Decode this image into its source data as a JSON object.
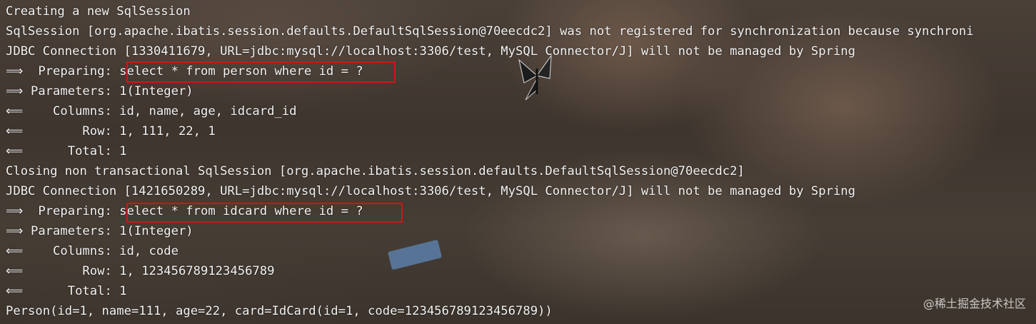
{
  "console": {
    "lines": [
      "Creating a new SqlSession",
      "SqlSession [org.apache.ibatis.session.defaults.DefaultSqlSession@70eecdc2] was not registered for synchronization because synchroni",
      "JDBC Connection [1330411679, URL=jdbc:mysql://localhost:3306/test, MySQL Connector/J] will not be managed by Spring",
      "⟹  Preparing: select * from person where id = ?",
      "⟹ Parameters: 1(Integer)",
      "⟸    Columns: id, name, age, idcard_id",
      "⟸        Row: 1, 111, 22, 1",
      "⟸      Total: 1",
      "Closing non transactional SqlSession [org.apache.ibatis.session.defaults.DefaultSqlSession@70eecdc2]",
      "JDBC Connection [1421650289, URL=jdbc:mysql://localhost:3306/test, MySQL Connector/J] will not be managed by Spring",
      "⟹  Preparing: select * from idcard where id = ?",
      "⟹ Parameters: 1(Integer)",
      "⟸    Columns: id, code",
      "⟸        Row: 1, 123456789123456789",
      "⟸      Total: 1",
      "Person(id=1, name=111, age=22, card=IdCard(id=1, code=123456789123456789))"
    ]
  },
  "highlights": {
    "color": "#d21414"
  },
  "watermark": "@稀土掘金技术社区",
  "colors": {
    "text": "#f2f2f2",
    "background": "#3e352e"
  }
}
